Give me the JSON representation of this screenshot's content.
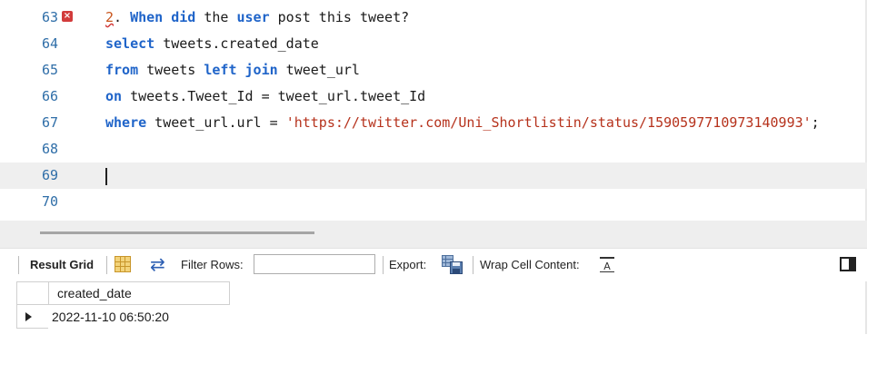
{
  "editor": {
    "lines": [
      {
        "num": "63",
        "has_error": true,
        "tokens": [
          {
            "t": "2",
            "cls": "err-num"
          },
          {
            "t": ". ",
            "cls": "plain"
          },
          {
            "t": "When",
            "cls": "kw"
          },
          {
            "t": " ",
            "cls": "plain"
          },
          {
            "t": "did",
            "cls": "kw"
          },
          {
            "t": " the ",
            "cls": "plain"
          },
          {
            "t": "user",
            "cls": "kw"
          },
          {
            "t": " post this tweet?",
            "cls": "plain"
          }
        ]
      },
      {
        "num": "64",
        "tokens": [
          {
            "t": "select",
            "cls": "kw"
          },
          {
            "t": " tweets.created_date",
            "cls": "plain"
          }
        ]
      },
      {
        "num": "65",
        "tokens": [
          {
            "t": "from",
            "cls": "kw"
          },
          {
            "t": " tweets ",
            "cls": "plain"
          },
          {
            "t": "left",
            "cls": "kw"
          },
          {
            "t": " ",
            "cls": "plain"
          },
          {
            "t": "join",
            "cls": "kw"
          },
          {
            "t": " tweet_url",
            "cls": "plain"
          }
        ]
      },
      {
        "num": "66",
        "tokens": [
          {
            "t": "on",
            "cls": "kw"
          },
          {
            "t": " tweets.Tweet_Id = tweet_url.tweet_Id",
            "cls": "plain"
          }
        ]
      },
      {
        "num": "67",
        "tokens": [
          {
            "t": "where",
            "cls": "kw"
          },
          {
            "t": " tweet_url.url = ",
            "cls": "plain"
          },
          {
            "t": "'https://twitter.com/Uni_Shortlistin/status/1590597710973140993'",
            "cls": "str"
          },
          {
            "t": ";",
            "cls": "plain"
          }
        ]
      },
      {
        "num": "68",
        "tokens": []
      },
      {
        "num": "69",
        "current": true,
        "tokens": []
      },
      {
        "num": "70",
        "tokens": []
      }
    ]
  },
  "toolbar": {
    "result_grid_label": "Result Grid",
    "filter_rows_label": "Filter Rows:",
    "filter_value": "",
    "export_label": "Export:",
    "wrap_label": "Wrap Cell Content:",
    "wrap_icon_glyph": "A"
  },
  "icons": {
    "error": "error-icon",
    "grid": "grid-view-icon",
    "refresh": "refresh-icon",
    "export": "export-save-icon",
    "wrap": "wrap-cell-icon",
    "panel": "panel-toggle-icon"
  },
  "colors": {
    "keyword": "#1f64c9",
    "string": "#b6321c",
    "line_number": "#2f6ea8",
    "error": "#d23b3b"
  },
  "result": {
    "columns": [
      "created_date"
    ],
    "rows": [
      [
        "2022-11-10 06:50:20"
      ]
    ]
  }
}
